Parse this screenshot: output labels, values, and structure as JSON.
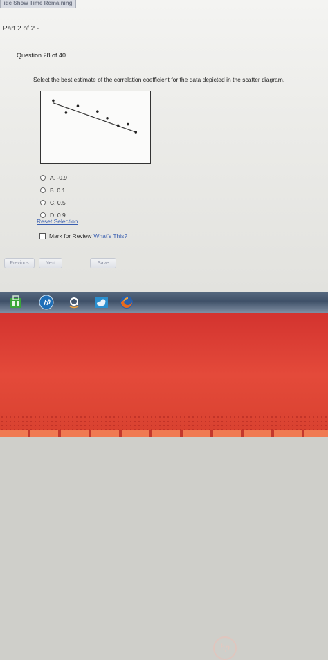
{
  "header": {
    "tab_label": "ide Show Time Remaining"
  },
  "part": {
    "label": "Part 2 of 2 -"
  },
  "question": {
    "number_label": "Question 28 of 40",
    "prompt": "Select the best estimate of the correlation coefficient for the data depicted in the scatter diagram."
  },
  "options": [
    {
      "label": "A. -0.9"
    },
    {
      "label": "B. 0.1"
    },
    {
      "label": "C. 0.5"
    },
    {
      "label": "D. 0.9"
    }
  ],
  "reset": {
    "label": "Reset Selection"
  },
  "review": {
    "label": "Mark for Review",
    "link": "What's This?"
  },
  "nav": {
    "previous": "Previous",
    "next": "Next",
    "save": "Save"
  },
  "chart_data": {
    "type": "scatter",
    "title": "",
    "xlabel": "",
    "ylabel": "",
    "xlim": [
      0,
      10
    ],
    "ylim": [
      0,
      10
    ],
    "grid": false,
    "points": [
      {
        "x": 0.7,
        "y": 9.4
      },
      {
        "x": 2.0,
        "y": 7.4
      },
      {
        "x": 3.2,
        "y": 8.5
      },
      {
        "x": 5.2,
        "y": 7.6
      },
      {
        "x": 6.2,
        "y": 6.5
      },
      {
        "x": 7.3,
        "y": 5.3
      },
      {
        "x": 8.3,
        "y": 5.5
      },
      {
        "x": 9.1,
        "y": 4.2
      }
    ],
    "trendline": {
      "x1": 0.7,
      "y1": 9.0,
      "x2": 9.1,
      "y2": 4.2
    }
  }
}
